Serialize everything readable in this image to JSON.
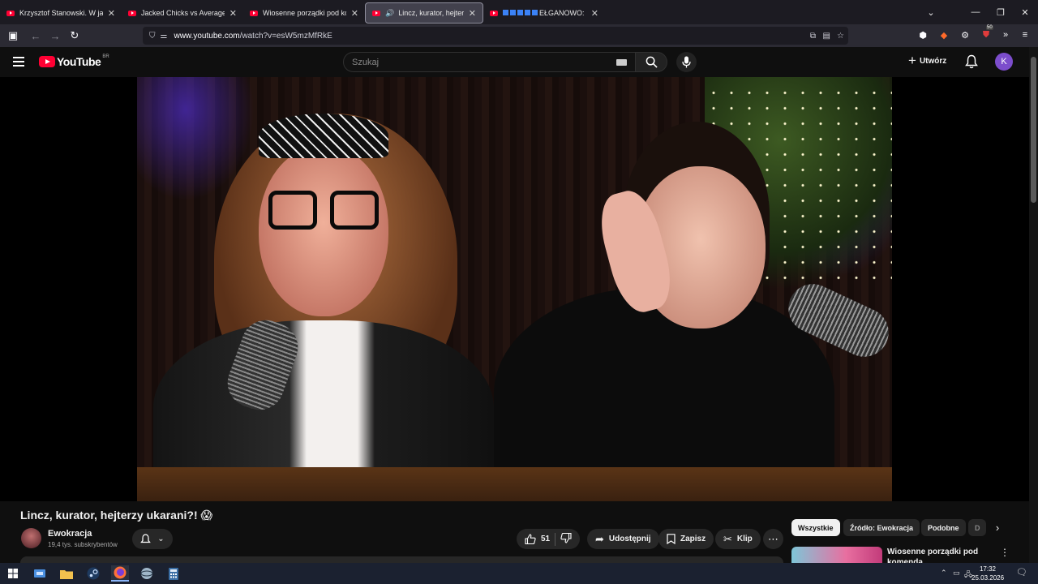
{
  "browser": {
    "tabs": [
      {
        "title": "Krzysztof Stanowski. W jakiej sp",
        "active": false
      },
      {
        "title": "Jacked Chicks vs Average Joes |",
        "active": false
      },
      {
        "title": "Wiosenne porządki pod komen",
        "active": false
      },
      {
        "title": "Lincz, kurator, hejterzy ukar",
        "active": true
      },
      {
        "title": "EŁGANOWO: D",
        "active": false
      }
    ],
    "url": {
      "domain": "www.youtube.com",
      "path": "/watch?v=esW5mzMfRkE"
    },
    "extension_badge": "50"
  },
  "masthead": {
    "logo_text": "YouTube",
    "country_code": "BR",
    "search_placeholder": "Szukaj",
    "create_label": "Utwórz",
    "avatar_letter": "K"
  },
  "video": {
    "title": "Lincz, kurator, hejterzy ukarani?! 😱",
    "channel_name": "Ewokracja",
    "subscribers": "19,4 tys. subskrybentów",
    "like_count": "51",
    "share_label": "Udostępnij",
    "save_label": "Zapisz",
    "clip_label": "Klip"
  },
  "sidebar": {
    "chips": [
      "Wszystkie",
      "Źródło: Ewokracja",
      "Podobne",
      "D"
    ],
    "active_chip": "Wszystkie",
    "recommendation": {
      "title": "Wiosenne porządki pod komenda"
    }
  },
  "taskbar": {
    "time": "17:32",
    "date": "25.03.2026"
  },
  "colors": {
    "youtube_red": "#ff0033",
    "background": "#0f0f0f",
    "avatar": "#7c4dcc"
  }
}
